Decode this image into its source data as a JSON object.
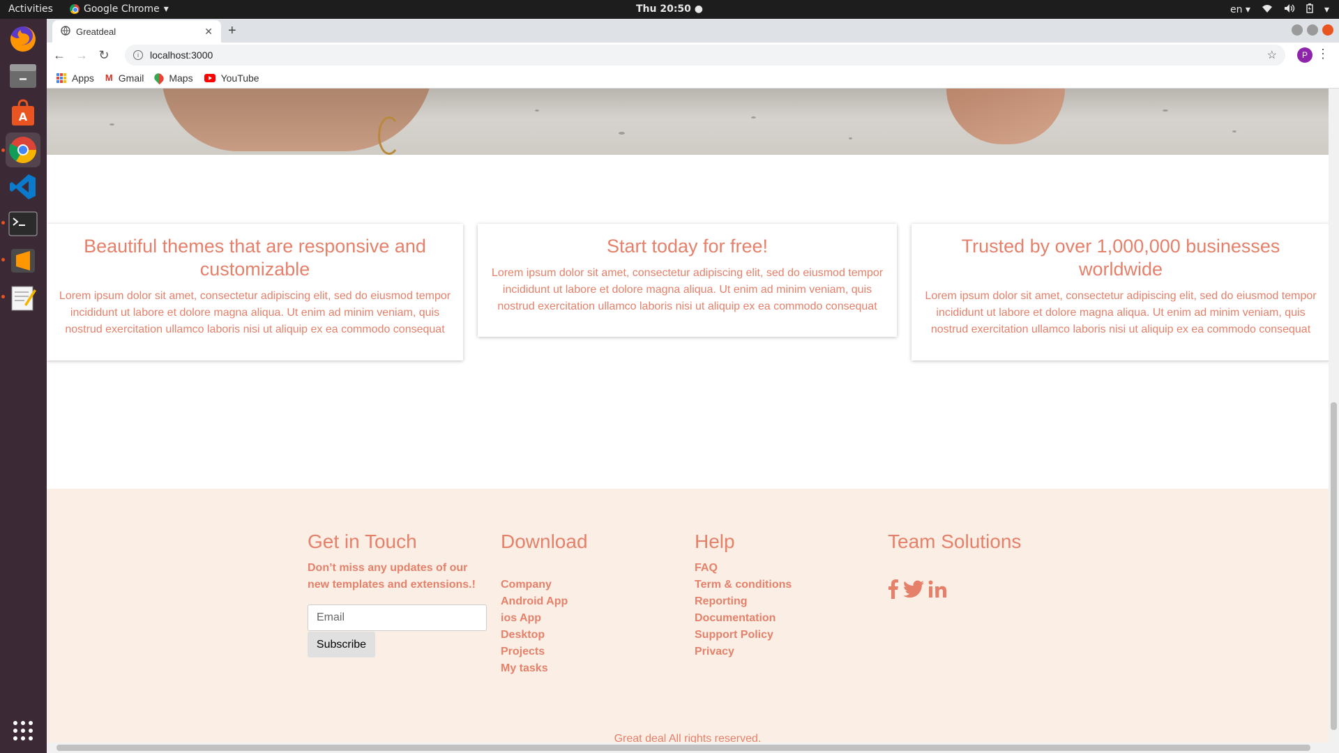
{
  "system": {
    "activities": "Activities",
    "app_name": "Google Chrome",
    "clock": "Thu 20:50",
    "language": "en"
  },
  "browser": {
    "tab_title": "Greatdeal",
    "url": "localhost:3000",
    "profile_initial": "P",
    "bookmarks": [
      "Apps",
      "Gmail",
      "Maps",
      "YouTube"
    ]
  },
  "features": [
    {
      "title": "Beautiful themes that are responsive and customizable",
      "text": "Lorem ipsum dolor sit amet, consectetur adipiscing elit, sed do eiusmod tempor incididunt ut labore et dolore magna aliqua. Ut enim ad minim veniam, quis nostrud exercitation ullamco laboris nisi ut aliquip ex ea commodo consequat"
    },
    {
      "title": "Start today for free!",
      "text": "Lorem ipsum dolor sit amet, consectetur adipiscing elit, sed do eiusmod tempor incididunt ut labore et dolore magna aliqua. Ut enim ad minim veniam, quis nostrud exercitation ullamco laboris nisi ut aliquip ex ea commodo consequat"
    },
    {
      "title": "Trusted by over 1,000,000 businesses worldwide",
      "text": "Lorem ipsum dolor sit amet, consectetur adipiscing elit, sed do eiusmod tempor incididunt ut labore et dolore magna aliqua. Ut enim ad minim veniam, quis nostrud exercitation ullamco laboris nisi ut aliquip ex ea commodo consequat"
    }
  ],
  "footer": {
    "get_in_touch": {
      "heading": "Get in Touch",
      "lead": "Don’t miss any updates of our new templates and extensions.!",
      "email_placeholder": "Email",
      "subscribe_label": "Subscribe"
    },
    "download": {
      "heading": "Download",
      "links": [
        "Company",
        "Android App",
        "ios App",
        "Desktop",
        "Projects",
        "My tasks"
      ]
    },
    "help": {
      "heading": "Help",
      "links": [
        "FAQ",
        "Term & conditions",
        "Reporting",
        "Documentation",
        "Support Policy",
        "Privacy"
      ]
    },
    "team": {
      "heading": "Team Solutions",
      "social": [
        "facebook-icon",
        "twitter-icon",
        "linkedin-icon"
      ]
    },
    "copyright": "Great deal All rights reserved."
  },
  "colors": {
    "accent": "#e5806a",
    "footer_bg": "#fbefe5"
  }
}
